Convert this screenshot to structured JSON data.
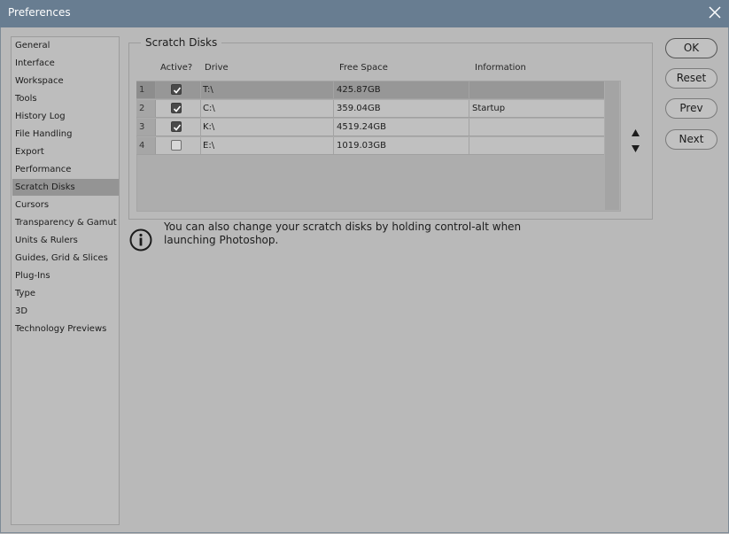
{
  "window": {
    "title": "Preferences"
  },
  "sidebar": {
    "items": [
      {
        "label": "General"
      },
      {
        "label": "Interface"
      },
      {
        "label": "Workspace"
      },
      {
        "label": "Tools"
      },
      {
        "label": "History Log"
      },
      {
        "label": "File Handling"
      },
      {
        "label": "Export"
      },
      {
        "label": "Performance"
      },
      {
        "label": "Scratch Disks"
      },
      {
        "label": "Cursors"
      },
      {
        "label": "Transparency & Gamut"
      },
      {
        "label": "Units & Rulers"
      },
      {
        "label": "Guides, Grid & Slices"
      },
      {
        "label": "Plug-Ins"
      },
      {
        "label": "Type"
      },
      {
        "label": "3D"
      },
      {
        "label": "Technology Previews"
      }
    ],
    "selected": "Scratch Disks"
  },
  "scratch_disks": {
    "group_title": "Scratch Disks",
    "columns": {
      "active": "Active?",
      "drive": "Drive",
      "free_space": "Free Space",
      "information": "Information"
    },
    "rows": [
      {
        "num": "1",
        "active": true,
        "drive": "T:\\",
        "free_space": "425.87GB",
        "information": ""
      },
      {
        "num": "2",
        "active": true,
        "drive": "C:\\",
        "free_space": "359.04GB",
        "information": "Startup"
      },
      {
        "num": "3",
        "active": true,
        "drive": "K:\\",
        "free_space": "4519.24GB",
        "information": ""
      },
      {
        "num": "4",
        "active": false,
        "drive": "E:\\",
        "free_space": "1019.03GB",
        "information": ""
      }
    ],
    "selected_row": 1
  },
  "info": {
    "text": "You can also change your scratch disks by holding control-alt when launching Photoshop."
  },
  "buttons": {
    "ok": "OK",
    "reset": "Reset",
    "prev": "Prev",
    "next": "Next"
  }
}
